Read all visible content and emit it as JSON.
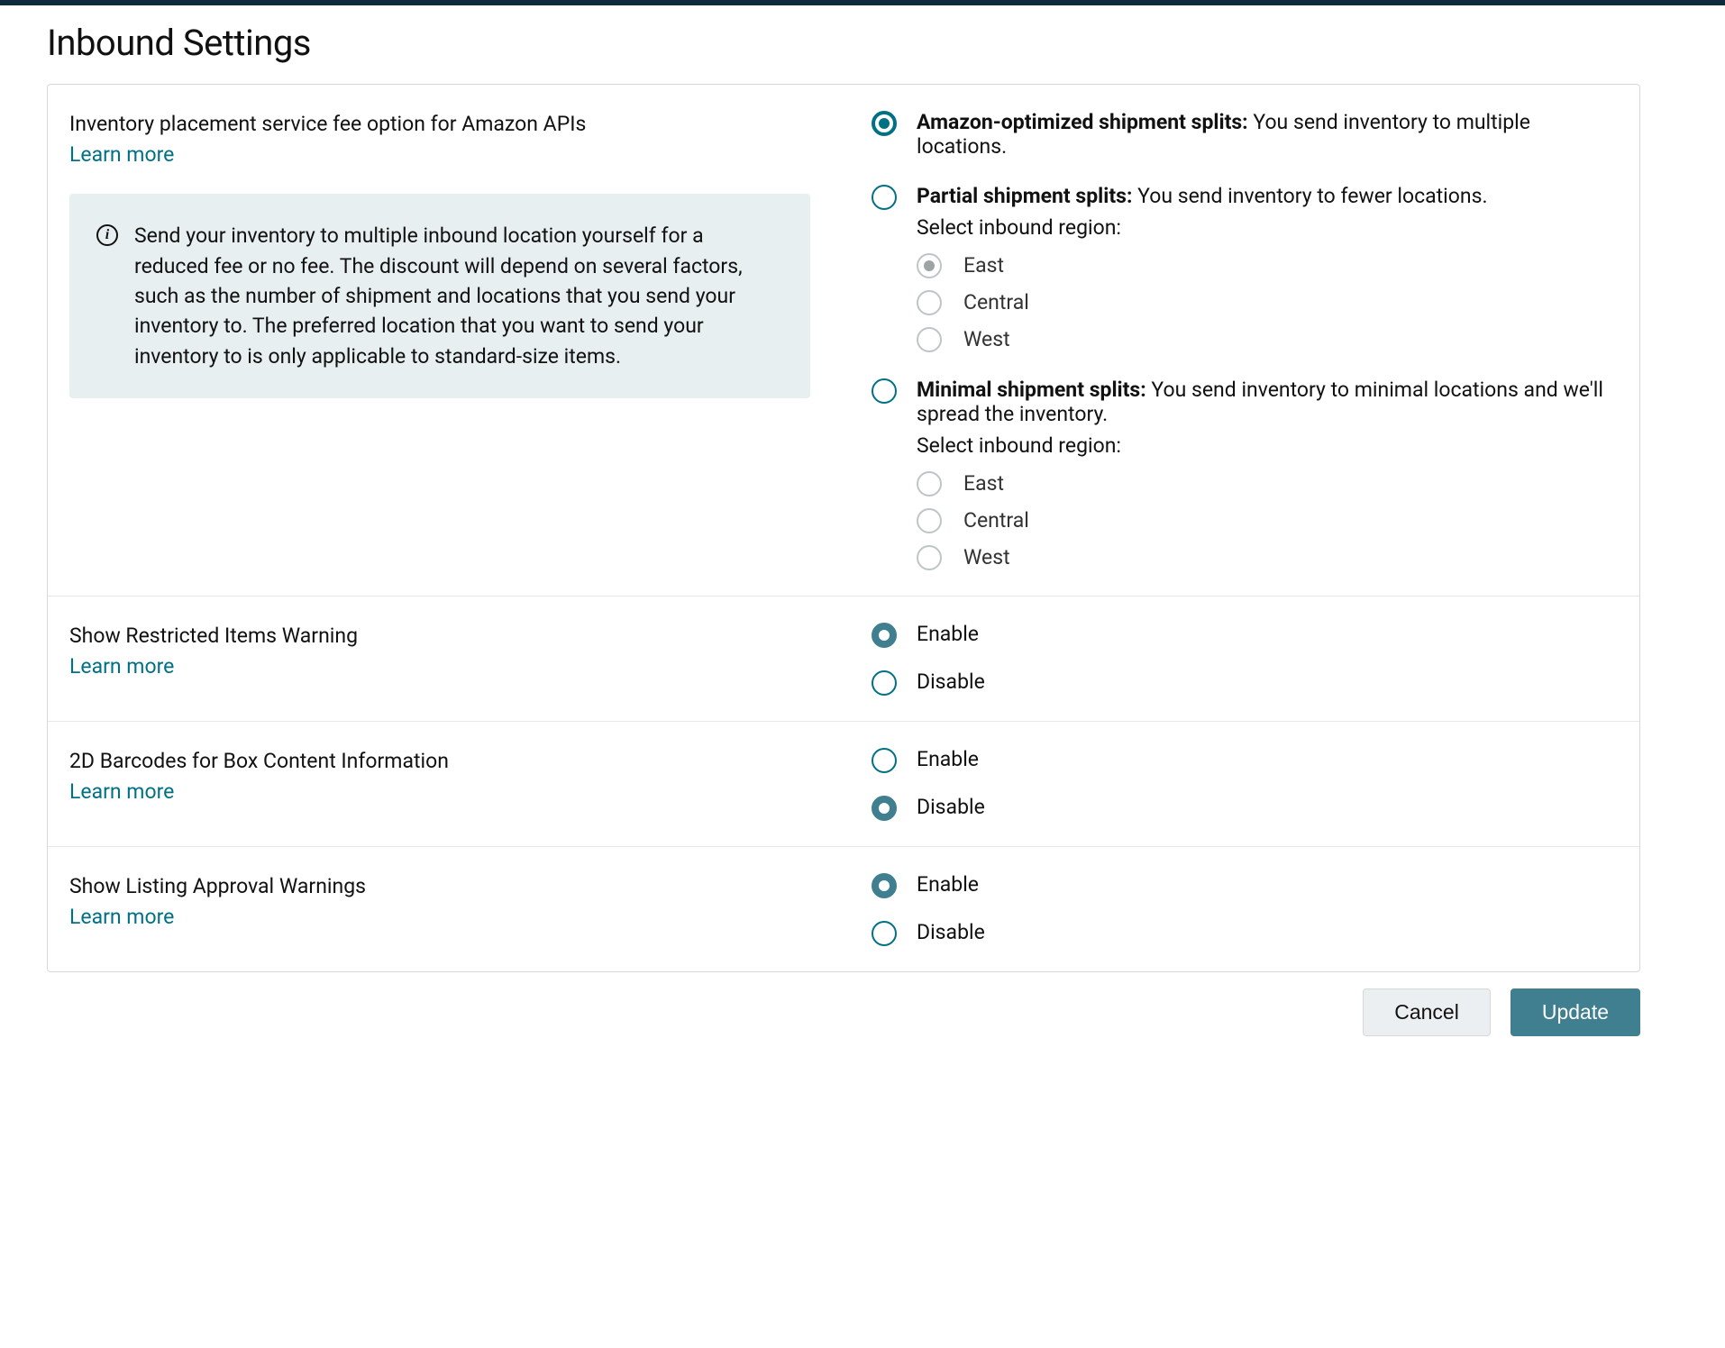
{
  "page_title": "Inbound Settings",
  "placement": {
    "title": "Inventory placement service fee option for Amazon APIs",
    "learn_more": "Learn more",
    "info": "Send your inventory to multiple inbound location yourself for a reduced fee or no fee. The discount will depend on several factors, such as the number of shipment and locations that you send your inventory to. The preferred location that you want to send your inventory to is only applicable to standard-size items.",
    "options": {
      "optimized": {
        "title": "Amazon-optimized shipment splits:",
        "desc": " You send inventory to multiple locations."
      },
      "partial": {
        "title": "Partial shipment splits:",
        "desc": " You send inventory to fewer locations.",
        "select_region": "Select inbound region:",
        "regions": {
          "east": "East",
          "central": "Central",
          "west": "West"
        }
      },
      "minimal": {
        "title": "Minimal shipment splits:",
        "desc": " You send inventory to minimal locations and we'll spread the inventory.",
        "select_region": "Select inbound region:",
        "regions": {
          "east": "East",
          "central": "Central",
          "west": "West"
        }
      }
    }
  },
  "restricted": {
    "title": "Show Restricted Items Warning",
    "learn_more": "Learn more",
    "enable": "Enable",
    "disable": "Disable"
  },
  "barcodes": {
    "title": "2D Barcodes for Box Content Information",
    "learn_more": "Learn more",
    "enable": "Enable",
    "disable": "Disable"
  },
  "listing": {
    "title": "Show Listing Approval Warnings",
    "learn_more": "Learn more",
    "enable": "Enable",
    "disable": "Disable"
  },
  "actions": {
    "cancel": "Cancel",
    "update": "Update"
  }
}
